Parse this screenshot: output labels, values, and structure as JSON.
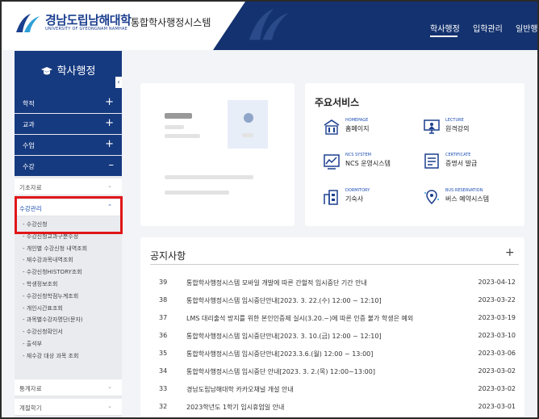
{
  "header": {
    "logo_ko": "경남도립남해대학",
    "logo_en": "UNIVERSITY OF GYEONGNAM NAMHAE",
    "system_title": "통합학사행정시스템",
    "nav": [
      "학사행정",
      "입학관리",
      "일반행"
    ]
  },
  "sidebar": {
    "title": "학사행정",
    "collapse_icon": "‹",
    "main_menu": [
      {
        "label": "학적",
        "sign": "+"
      },
      {
        "label": "교과",
        "sign": "+"
      },
      {
        "label": "수업",
        "sign": "+"
      },
      {
        "label": "수강",
        "sign": "–"
      }
    ],
    "sub_menu_top": [
      {
        "label": "기초자료",
        "chev": "⌄"
      },
      {
        "label": "수강관리",
        "chev": "⌃"
      }
    ],
    "sub_items": [
      "- 수강신청",
      "- 수강신청교과구분수정",
      "- 개인별 수강신청 내역조회",
      "- 재수강과목내역조회",
      "- 수강신청HISTORY조회",
      "- 학생정보조회",
      "- 수강신청학점누계조회",
      "- 개인시간표조회",
      "- 과목별수강자명단(문자)",
      "- 수강신청확인서",
      "- 출석부",
      "- 재수강 대상 과목 조회"
    ],
    "sub_menu_bottom": [
      {
        "label": "통계자료",
        "chev": "⌄"
      },
      {
        "label": "계절학기",
        "chev": "⌄"
      }
    ]
  },
  "services": {
    "title": "주요서비스",
    "items": [
      {
        "en": "HOMEPAGE",
        "ko": "홈페이지",
        "icon": "building-icon"
      },
      {
        "en": "LECTURE",
        "ko": "원격강의",
        "icon": "lecture-icon"
      },
      {
        "en": "NCS SYSTEM",
        "ko": "NCS 운영시스템",
        "icon": "chart-icon"
      },
      {
        "en": "CERTIFICATE",
        "ko": "증명서 발급",
        "icon": "certificate-icon"
      },
      {
        "en": "DORMITORY",
        "ko": "기숙사",
        "icon": "dormitory-icon"
      },
      {
        "en": "BUS RESERVATION",
        "ko": "버스 예약시스템",
        "icon": "bus-icon"
      }
    ]
  },
  "notices": {
    "title": "공지사항",
    "more": "+",
    "rows": [
      {
        "num": "39",
        "title": "통합학사행정시스템 모바일 개발에 따른 간헐적 임시중단 기간 안내",
        "date": "2023-04-12"
      },
      {
        "num": "38",
        "title": "통합학사행정시스템 임시중단안내[2023. 3. 22.(수) 12:00 ~ 12:10]",
        "date": "2023-03-22"
      },
      {
        "num": "37",
        "title": "LMS 대리출석 방지를 위한 본인인증제 실시(3.20.~)에 따른 인증 불가 학생은 예외",
        "date": "2023-03-19"
      },
      {
        "num": "36",
        "title": "통합학사행정시스템 임시중단안내[2023. 3. 10.(금) 12:00 ~ 12:10]",
        "date": "2023-03-10"
      },
      {
        "num": "35",
        "title": "통합학사행정시스템 임시중단안내[2023.3.6.(월) 12:00 ~ 13:00]",
        "date": "2023-03-06"
      },
      {
        "num": "34",
        "title": "통합학사행정시스템 임시중단 안내[2023. 3. 2.(목) 12:00~13:00]",
        "date": "2023-03-02"
      },
      {
        "num": "33",
        "title": "경남도립남해대학 카카오채널 개설 안내",
        "date": "2023-03-02"
      },
      {
        "num": "32",
        "title": "2023학년도 1학기 임시휴업일 안내",
        "date": "2023-03-01"
      }
    ]
  }
}
